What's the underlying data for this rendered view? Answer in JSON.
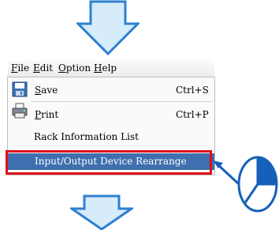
{
  "menubar": {
    "file": "File",
    "edit": "Edit",
    "option": "Option",
    "help": "Help"
  },
  "file_menu": {
    "items": [
      {
        "label": "Save",
        "shortcut": "Ctrl+S",
        "icon": "save-disk-icon"
      },
      {
        "label": "Print",
        "shortcut": "Ctrl+P",
        "icon": "printer-icon"
      },
      {
        "label": "Rack Information List"
      },
      {
        "label": "Input/Output Device Rearrange",
        "highlighted": true
      }
    ]
  },
  "colors": {
    "arrow_fill": "#d6ecfb",
    "arrow_stroke": "#2d7fd0",
    "selection": "#3f6fae",
    "callout_box": "#e0101a",
    "step_clock_stroke": "#1560b8"
  },
  "step_indicator": {
    "icon": "step-clock-icon",
    "filled_fraction": 0.25
  }
}
